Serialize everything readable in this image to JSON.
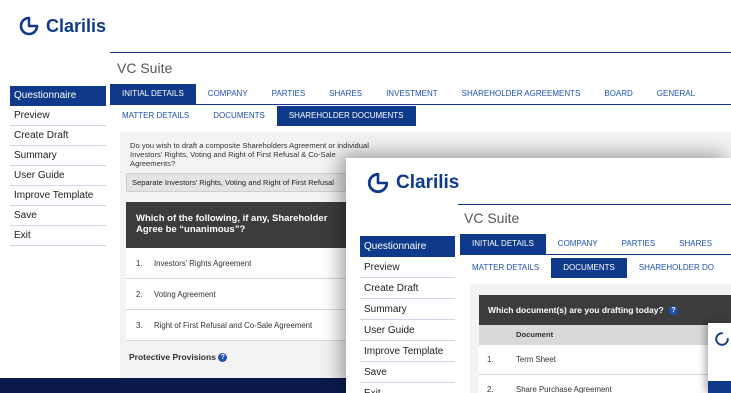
{
  "brand": {
    "name": "Clarilis"
  },
  "suite": "VC Suite",
  "sidebar": {
    "items": [
      {
        "label": "Questionnaire"
      },
      {
        "label": "Preview"
      },
      {
        "label": "Create Draft"
      },
      {
        "label": "Summary"
      },
      {
        "label": "User Guide"
      },
      {
        "label": "Improve Template"
      },
      {
        "label": "Save"
      },
      {
        "label": "Exit"
      }
    ]
  },
  "back_window": {
    "tabs_primary": [
      "INITIAL DETAILS",
      "COMPANY",
      "PARTIES",
      "SHARES",
      "INVESTMENT",
      "SHAREHOLDER AGREEMENTS",
      "BOARD",
      "GENERAL"
    ],
    "tabs_secondary": [
      "MATTER DETAILS",
      "DOCUMENTS",
      "SHAREHOLDER DOCUMENTS"
    ],
    "question1": "Do you wish to draft a composite Shareholders Agreement or individual Investors' Rights, Voting and Right of First Refusal & Co-Sale Agreements?",
    "question1_answer": "Separate Investors' Rights, Voting and Right of First Refusal",
    "question2": "Which of the following, if any, Shareholder Agree be “unanimous”?",
    "agreements": [
      {
        "num": "1.",
        "label": "Investors' Rights Agreement"
      },
      {
        "num": "2.",
        "label": "Voting Agreement"
      },
      {
        "num": "3.",
        "label": "Right of First Refusal and Co-Sale Agreement"
      }
    ],
    "protective_label": "Protective Provisions"
  },
  "front_window": {
    "tabs_primary": [
      "INITIAL DETAILS",
      "COMPANY",
      "PARTIES",
      "SHARES"
    ],
    "tabs_secondary": [
      "MATTER DETAILS",
      "DOCUMENTS",
      "SHAREHOLDER DO"
    ],
    "question": "Which document(s) are you drafting today?",
    "column_header": "Document",
    "documents": [
      {
        "num": "1.",
        "label": "Term Sheet"
      },
      {
        "num": "2.",
        "label": "Share Purchase Agreement"
      }
    ]
  },
  "colors": {
    "brand_blue": "#0f3a8c",
    "tab_text": "#1e50b4",
    "background": "#0a1a4a"
  }
}
